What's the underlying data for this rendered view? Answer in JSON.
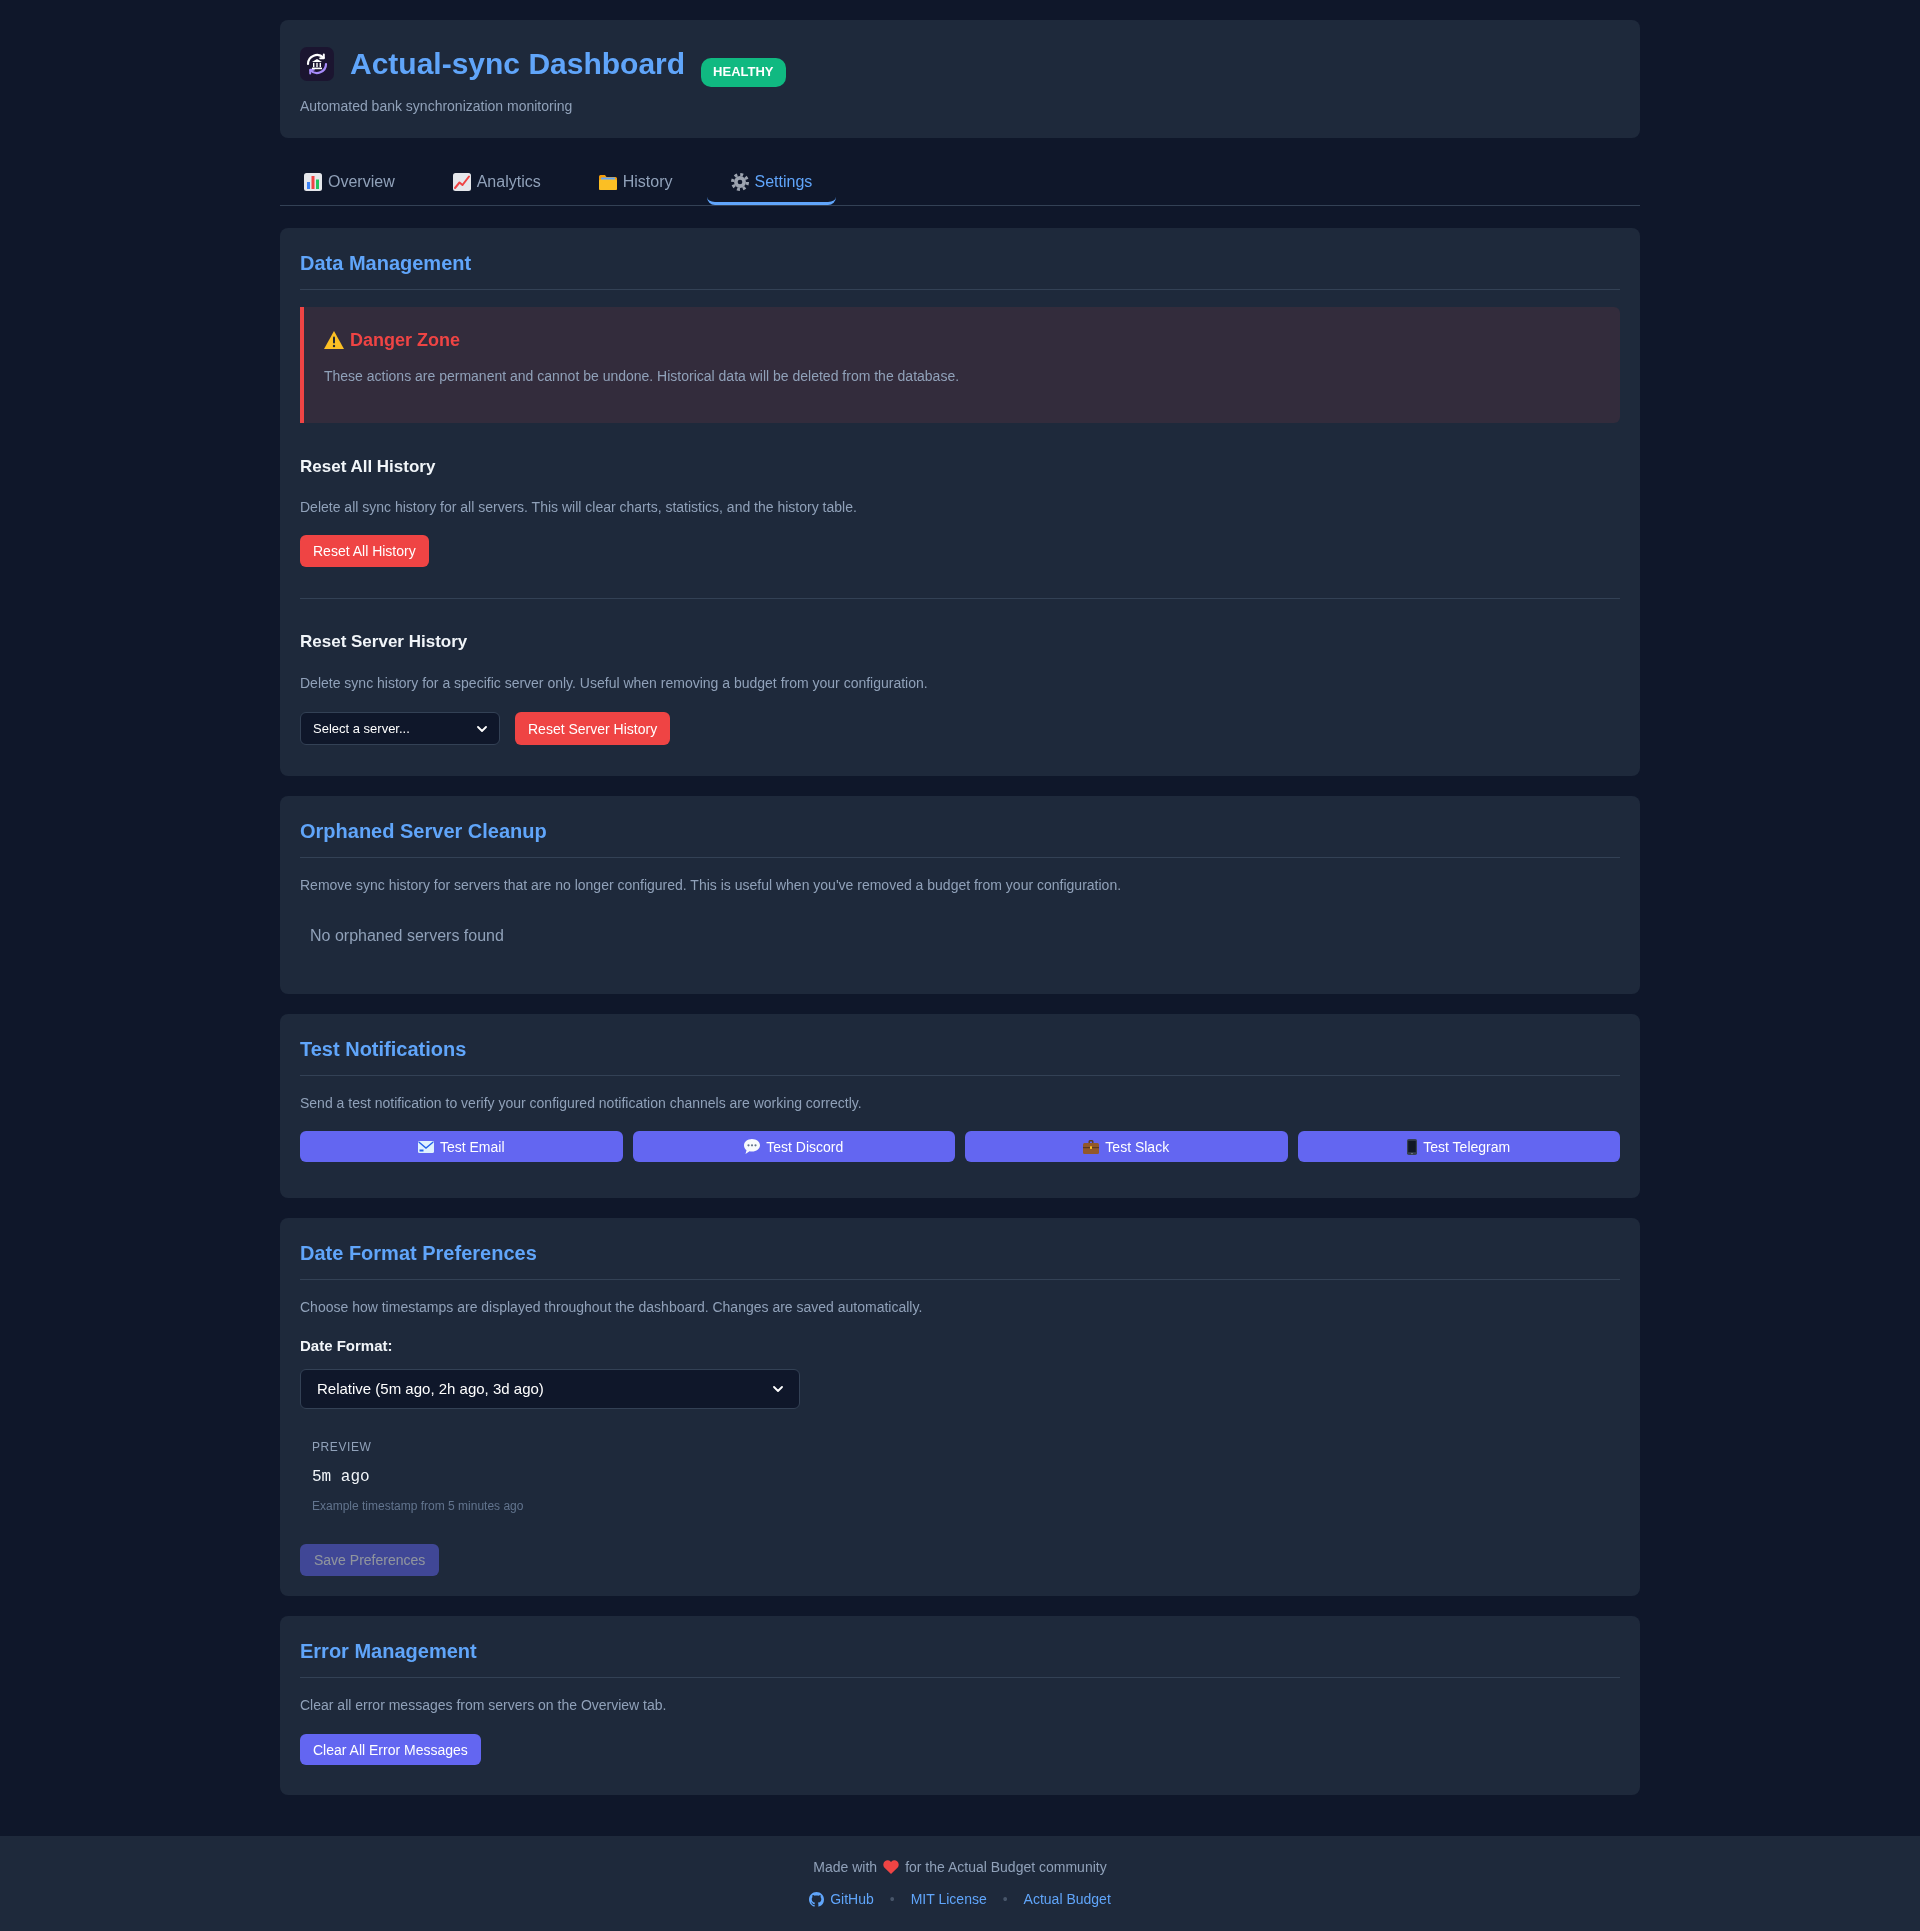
{
  "header": {
    "title": "Actual-sync Dashboard",
    "status": {
      "kind": "healthy",
      "label": "HEALTHY"
    },
    "subtitle": "Automated bank synchronization monitoring"
  },
  "tabs": [
    {
      "kind": "overview",
      "label": "Overview",
      "selected": false
    },
    {
      "kind": "analytics",
      "label": "Analytics",
      "selected": false
    },
    {
      "kind": "history",
      "label": "History",
      "selected": false
    },
    {
      "kind": "settings",
      "label": "Settings",
      "selected": true
    }
  ],
  "sections": [
    {
      "title": "Data Management",
      "danger": {
        "title": "Danger Zone",
        "text": "These actions are permanent and cannot be undone. Historical data will be deleted from the database."
      },
      "actions": [
        {
          "title": "Reset All History",
          "description": "Delete all sync history for all servers. This will clear charts, statistics, and the history table.",
          "button": "Reset All History"
        },
        {
          "title": "Reset Server History",
          "description": "Delete sync history for a specific server only. Useful when removing a budget from your configuration.",
          "select": {
            "value": "Select a server..."
          },
          "button": "Reset Server History"
        }
      ]
    },
    {
      "title": "Orphaned Server Cleanup",
      "description": "Remove sync history for servers that are no longer configured. This is useful when you've removed a budget from your configuration.",
      "empty_message": "No orphaned servers found"
    },
    {
      "title": "Test Notifications",
      "description": "Send a test notification to verify your configured notification channels are working correctly.",
      "buttons": [
        {
          "kind": "email",
          "label": "Test Email"
        },
        {
          "kind": "discord",
          "label": "Test Discord"
        },
        {
          "kind": "slack",
          "label": "Test Slack"
        },
        {
          "kind": "telegram",
          "label": "Test Telegram"
        }
      ]
    },
    {
      "title": "Date Format Preferences",
      "description": "Choose how timestamps are displayed throughout the dashboard. Changes are saved automatically.",
      "field_label": "Date Format:",
      "select": {
        "value": "Relative (5m ago, 2h ago, 3d ago)"
      },
      "preview": {
        "label": "PREVIEW",
        "value": "5m ago",
        "note": "Example timestamp from 5 minutes ago"
      },
      "save_button": {
        "label": "Save Preferences",
        "disabled": true
      }
    },
    {
      "title": "Error Management",
      "description": "Clear all error messages from servers on the Overview tab.",
      "button": "Clear All Error Messages"
    }
  ],
  "footer": {
    "tagline_start": "Made with",
    "tagline_end": "for the Actual Budget community",
    "links": [
      {
        "kind": "github",
        "label": "GitHub"
      },
      {
        "kind": "separator",
        "label": "•"
      },
      {
        "kind": "link",
        "label": "MIT License"
      },
      {
        "kind": "separator",
        "label": "•"
      },
      {
        "kind": "link",
        "label": "Actual Budget"
      }
    ]
  }
}
